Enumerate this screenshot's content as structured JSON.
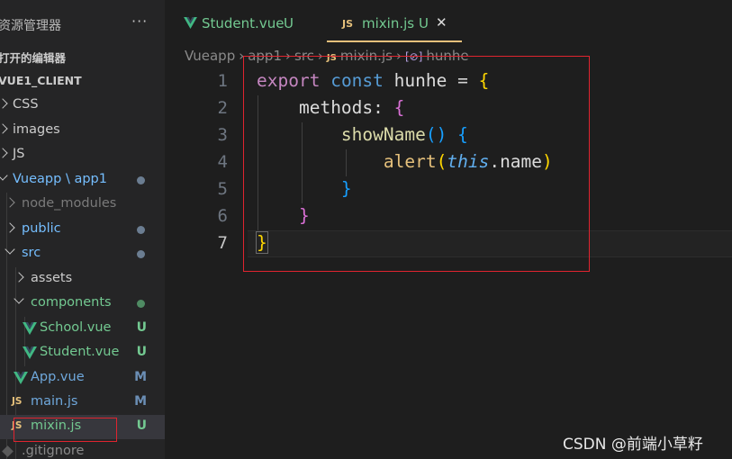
{
  "sidebar": {
    "title": "资源管理器",
    "more": "···",
    "open_editors": "打开的编辑器",
    "project": "VUE1_CLIENT",
    "items": [
      {
        "label": "CSS"
      },
      {
        "label": "images"
      },
      {
        "label": "JS"
      },
      {
        "label": "Vueapp \\ app1"
      },
      {
        "label": "node_modules"
      },
      {
        "label": "public"
      },
      {
        "label": "src"
      },
      {
        "label": "assets"
      },
      {
        "label": "components"
      },
      {
        "label": "School.vue",
        "badge": "U"
      },
      {
        "label": "Student.vue",
        "badge": "U"
      },
      {
        "label": "App.vue",
        "badge": "M"
      },
      {
        "label": "main.js",
        "badge": "M"
      },
      {
        "label": "mixin.js",
        "badge": "U"
      },
      {
        "label": ".gitignore"
      }
    ]
  },
  "tabs": [
    {
      "label": "Student.vue",
      "badge": "U"
    },
    {
      "label": "mixin.js",
      "badge": "U",
      "close": "✕"
    }
  ],
  "breadcrumb": [
    "Vueapp",
    "app1",
    "src",
    "mixin.js",
    "hunhe"
  ],
  "editor": {
    "line_numbers": [
      "1",
      "2",
      "3",
      "4",
      "5",
      "6",
      "7"
    ]
  },
  "icons": {
    "vue": "vue-icon",
    "js": "JS",
    "symbol": "[⊘]"
  },
  "colors": {
    "modified_green": "#73c991",
    "modified_orange": "#e2c08d",
    "accent": "#e5c07b",
    "annotation_red": "#e0242f"
  },
  "watermark": "CSDN @前端小草籽"
}
